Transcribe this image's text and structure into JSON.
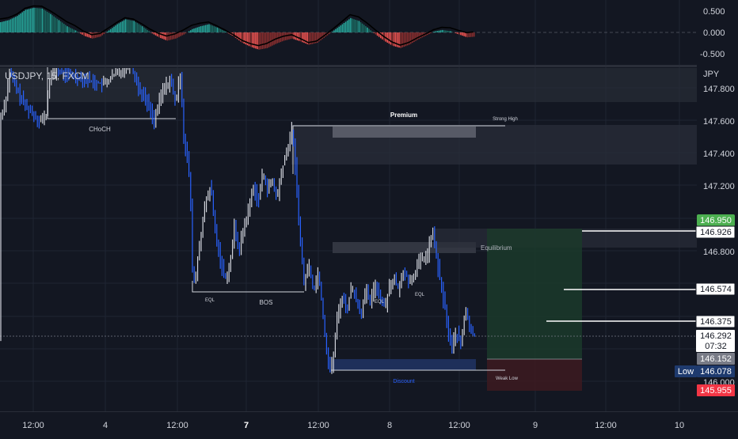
{
  "header": {
    "symbol_line": "USDJPY, 15, FXCM",
    "currency": "JPY"
  },
  "oscillator": {
    "axis_labels": [
      "0.500",
      "0.000",
      "-0.500"
    ]
  },
  "price_axis": {
    "ticks": [
      "147.800",
      "147.600",
      "147.400",
      "147.200",
      "146.800",
      "146.000"
    ]
  },
  "price_tags": [
    {
      "id": "tp-tag",
      "value": "146.950",
      "bg": "#4caf50",
      "fg": "#ffffff"
    },
    {
      "id": "entry-zone-tag",
      "value": "146.926",
      "bg": "#ffffff",
      "fg": "#131722"
    },
    {
      "id": "level-tag-1",
      "value": "146.574",
      "bg": "#ffffff",
      "fg": "#131722"
    },
    {
      "id": "level-tag-2",
      "value": "146.375",
      "bg": "#ffffff",
      "fg": "#131722"
    },
    {
      "id": "last-price-tag",
      "value": "146.292",
      "countdown": "07:32",
      "bg": "#ffffff",
      "fg": "#131722"
    },
    {
      "id": "entry-tag",
      "value": "146.152",
      "bg": "#787b86",
      "fg": "#ffffff"
    },
    {
      "id": "low-tag",
      "value": "146.078",
      "label": "Low",
      "bg": "#1e3a6e",
      "fg": "#ffffff"
    },
    {
      "id": "sl-tag",
      "value": "145.955",
      "bg": "#f23645",
      "fg": "#ffffff"
    }
  ],
  "time_axis": {
    "ticks": [
      {
        "label": "12:00",
        "bold": false
      },
      {
        "label": "4",
        "bold": false
      },
      {
        "label": "12:00",
        "bold": false
      },
      {
        "label": "7",
        "bold": true
      },
      {
        "label": "12:00",
        "bold": false
      },
      {
        "label": "8",
        "bold": false
      },
      {
        "label": "12:00",
        "bold": false
      },
      {
        "label": "9",
        "bold": false
      },
      {
        "label": "12:00",
        "bold": false
      },
      {
        "label": "10",
        "bold": false
      }
    ]
  },
  "annotations": {
    "choch": "CHoCH",
    "premium": "Premium",
    "strong_high": "Strong High",
    "equilibrium": "Equilibrium",
    "eql": "EQL",
    "bos": "BOS",
    "discount": "Discount",
    "weak_low": "Weak Low"
  },
  "colors": {
    "background": "#131722",
    "grid": "#1f2433",
    "up_candle": "#d1d4dc",
    "down_candle": "#2962ff",
    "osc_up": "#26a69a",
    "osc_down": "#ef5350",
    "long_zone": "#1b3a2a",
    "short_zone": "#3b1a20",
    "discount_zone": "#1e2f5a"
  },
  "chart_data": {
    "type": "candlestick",
    "symbol": "USDJPY",
    "timeframe": "15",
    "source": "FXCM",
    "ylim": [
      145.92,
      147.9
    ],
    "key_levels": {
      "strong_high": 147.56,
      "equilibrium": 146.82,
      "weak_low": 146.07,
      "last_price": 146.292,
      "day_low": 146.078
    },
    "position": {
      "take_profit": 146.95,
      "entry": 146.152,
      "stop_loss": 145.955
    },
    "horizontal_levels": [
      146.926,
      146.574,
      146.375
    ],
    "price_path": [
      [
        0,
        147.6
      ],
      [
        8,
        147.75
      ],
      [
        12,
        147.9
      ],
      [
        20,
        147.8
      ],
      [
        30,
        147.7
      ],
      [
        40,
        147.65
      ],
      [
        50,
        147.6
      ],
      [
        58,
        147.62
      ],
      [
        62,
        147.85
      ],
      [
        70,
        147.9
      ],
      [
        90,
        147.88
      ],
      [
        110,
        147.85
      ],
      [
        130,
        147.82
      ],
      [
        150,
        147.9
      ],
      [
        165,
        147.95
      ],
      [
        175,
        147.8
      ],
      [
        185,
        147.72
      ],
      [
        195,
        147.6
      ],
      [
        205,
        147.78
      ],
      [
        215,
        147.85
      ],
      [
        222,
        147.7
      ],
      [
        228,
        147.9
      ],
      [
        232,
        147.5
      ],
      [
        236,
        147.38
      ],
      [
        240,
        147.2
      ],
      [
        243,
        146.7
      ],
      [
        246,
        146.58
      ],
      [
        252,
        146.85
      ],
      [
        260,
        147.1
      ],
      [
        266,
        147.2
      ],
      [
        272,
        146.9
      ],
      [
        278,
        146.75
      ],
      [
        284,
        146.63
      ],
      [
        290,
        146.7
      ],
      [
        296,
        146.95
      ],
      [
        302,
        146.8
      ],
      [
        308,
        146.95
      ],
      [
        314,
        147.05
      ],
      [
        320,
        147.2
      ],
      [
        326,
        147.1
      ],
      [
        332,
        147.28
      ],
      [
        338,
        147.18
      ],
      [
        344,
        147.22
      ],
      [
        350,
        147.12
      ],
      [
        356,
        147.3
      ],
      [
        362,
        147.4
      ],
      [
        368,
        147.55
      ],
      [
        372,
        147.38
      ],
      [
        376,
        147.1
      ],
      [
        380,
        146.8
      ],
      [
        384,
        146.6
      ],
      [
        390,
        146.72
      ],
      [
        396,
        146.55
      ],
      [
        402,
        146.68
      ],
      [
        408,
        146.4
      ],
      [
        412,
        146.2
      ],
      [
        416,
        146.08
      ],
      [
        420,
        146.1
      ],
      [
        426,
        146.4
      ],
      [
        432,
        146.52
      ],
      [
        438,
        146.44
      ],
      [
        444,
        146.58
      ],
      [
        450,
        146.5
      ],
      [
        456,
        146.42
      ],
      [
        462,
        146.55
      ],
      [
        468,
        146.48
      ],
      [
        474,
        146.6
      ],
      [
        480,
        146.52
      ],
      [
        486,
        146.45
      ],
      [
        492,
        146.6
      ],
      [
        498,
        146.62
      ],
      [
        504,
        146.55
      ],
      [
        510,
        146.7
      ],
      [
        516,
        146.6
      ],
      [
        522,
        146.65
      ],
      [
        528,
        146.72
      ],
      [
        534,
        146.75
      ],
      [
        540,
        146.78
      ],
      [
        546,
        146.92
      ],
      [
        550,
        146.8
      ],
      [
        556,
        146.6
      ],
      [
        562,
        146.45
      ],
      [
        566,
        146.3
      ],
      [
        570,
        146.2
      ],
      [
        576,
        146.3
      ],
      [
        582,
        146.22
      ],
      [
        588,
        146.45
      ],
      [
        594,
        146.3
      ],
      [
        600,
        146.28
      ]
    ],
    "oscillator_values": [
      0.25,
      0.3,
      0.4,
      0.55,
      0.6,
      0.58,
      0.45,
      0.3,
      0.15,
      0.05,
      -0.08,
      -0.15,
      -0.1,
      0.05,
      0.2,
      0.32,
      0.28,
      0.15,
      0.0,
      -0.12,
      -0.2,
      -0.15,
      -0.05,
      0.08,
      0.15,
      0.2,
      0.12,
      0.02,
      -0.1,
      -0.25,
      -0.35,
      -0.42,
      -0.38,
      -0.28,
      -0.2,
      -0.15,
      -0.22,
      -0.3,
      -0.25,
      -0.1,
      0.05,
      0.2,
      0.35,
      0.28,
      0.12,
      -0.05,
      -0.2,
      -0.32,
      -0.38,
      -0.3,
      -0.18,
      -0.08,
      0.02,
      0.06,
      0.03,
      -0.05,
      -0.12,
      -0.1
    ]
  }
}
